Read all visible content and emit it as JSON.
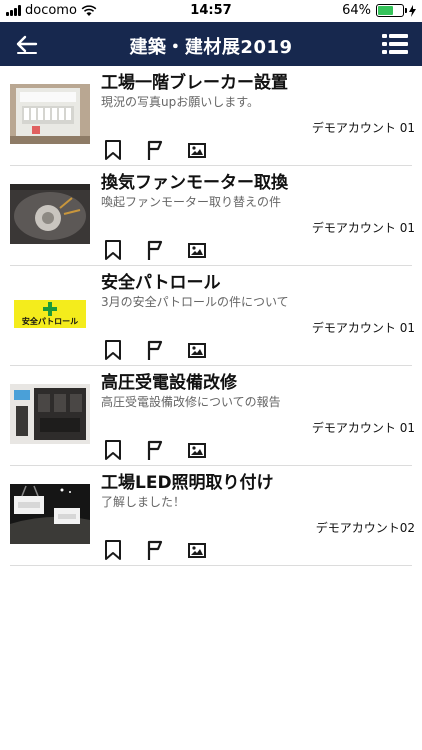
{
  "status": {
    "carrier": "docomo",
    "time": "14:57",
    "battery": "64%",
    "battery_level": 0.64
  },
  "nav": {
    "title": "建築・建材展2019",
    "back_icon": "back-arrow-icon",
    "menu_icon": "list-menu-icon"
  },
  "colors": {
    "nav_background": "#17284e",
    "divider": "#dcdcdc",
    "secondary_text": "#666666"
  },
  "posts": [
    {
      "title": "工場一階ブレーカー設置",
      "desc": "現況の写真upお願いします。",
      "author": "デモアカウント 01",
      "thumb": "breaker-panel-photo"
    },
    {
      "title": "換気ファンモーター取換",
      "desc": "喚起ファンモーター取り替えの件",
      "author": "デモアカウント 01",
      "thumb": "fan-motor-photo"
    },
    {
      "title": "安全パトロール",
      "desc": "3月の安全パトロールの件について",
      "author": "デモアカウント 01",
      "thumb": "safety-patrol-sign",
      "thumb_text": "安全パトロール"
    },
    {
      "title": "高圧受電設備改修",
      "desc": "高圧受電設備改修についての報告",
      "author": "デモアカウント 01",
      "thumb": "electrical-equipment-photo"
    },
    {
      "title": "工場LED照明取り付け",
      "desc": "了解しました！",
      "author": "デモアカウント02",
      "thumb": "led-lighting-photo"
    }
  ],
  "actions": [
    "bookmark-icon",
    "flag-icon",
    "image-icon"
  ]
}
